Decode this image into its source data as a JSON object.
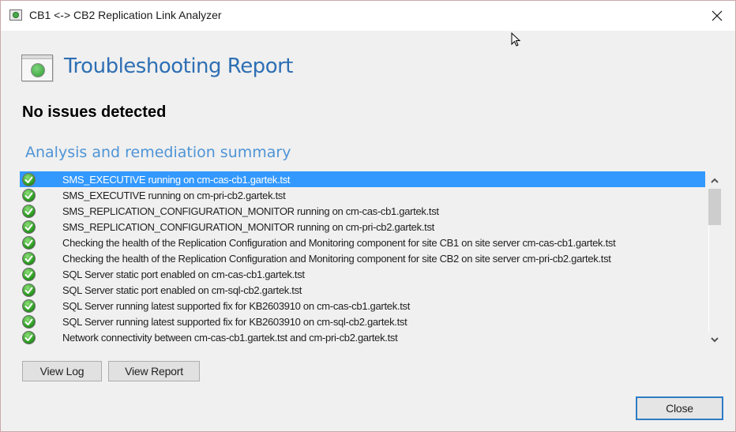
{
  "window": {
    "title": "CB1 <-> CB2 Replication Link Analyzer",
    "close_icon": "close-icon"
  },
  "header": {
    "icon": "replication-app-icon",
    "title": "Troubleshooting Report"
  },
  "status": {
    "message": "No issues detected"
  },
  "summary": {
    "heading": "Analysis and remediation summary",
    "items": [
      {
        "status": "success",
        "icon": "check-icon",
        "text": "SMS_EXECUTIVE running on cm-cas-cb1.gartek.tst",
        "selected": true
      },
      {
        "status": "success",
        "icon": "check-icon",
        "text": "SMS_EXECUTIVE running on cm-pri-cb2.gartek.tst",
        "selected": false
      },
      {
        "status": "success",
        "icon": "check-icon",
        "text": "SMS_REPLICATION_CONFIGURATION_MONITOR running on cm-cas-cb1.gartek.tst",
        "selected": false
      },
      {
        "status": "success",
        "icon": "check-icon",
        "text": "SMS_REPLICATION_CONFIGURATION_MONITOR running on cm-pri-cb2.gartek.tst",
        "selected": false
      },
      {
        "status": "success",
        "icon": "check-icon",
        "text": "Checking the health of the Replication Configuration and Monitoring component for site CB1 on site server cm-cas-cb1.gartek.tst",
        "selected": false
      },
      {
        "status": "success",
        "icon": "check-icon",
        "text": "Checking the health of the Replication Configuration and Monitoring component for site CB2 on site server cm-pri-cb2.gartek.tst",
        "selected": false
      },
      {
        "status": "success",
        "icon": "check-icon",
        "text": "SQL Server static port enabled on cm-cas-cb1.gartek.tst",
        "selected": false
      },
      {
        "status": "success",
        "icon": "check-icon",
        "text": "SQL Server static port enabled on cm-sql-cb2.gartek.tst",
        "selected": false
      },
      {
        "status": "success",
        "icon": "check-icon",
        "text": "SQL Server running latest supported fix for KB2603910 on cm-cas-cb1.gartek.tst",
        "selected": false
      },
      {
        "status": "success",
        "icon": "check-icon",
        "text": "SQL Server running latest supported fix for KB2603910 on cm-sql-cb2.gartek.tst",
        "selected": false
      },
      {
        "status": "success",
        "icon": "check-icon",
        "text": "Network connectivity between cm-cas-cb1.gartek.tst and cm-pri-cb2.gartek.tst",
        "selected": false
      }
    ]
  },
  "buttons": {
    "view_log": "View Log",
    "view_report": "View Report",
    "close": "Close"
  },
  "colors": {
    "title_blue": "#2e6fb4",
    "heading_blue": "#4e94d6",
    "selection": "#3399ff",
    "default_button_border": "#2f7cc4",
    "success_green": "#2f9e24"
  }
}
